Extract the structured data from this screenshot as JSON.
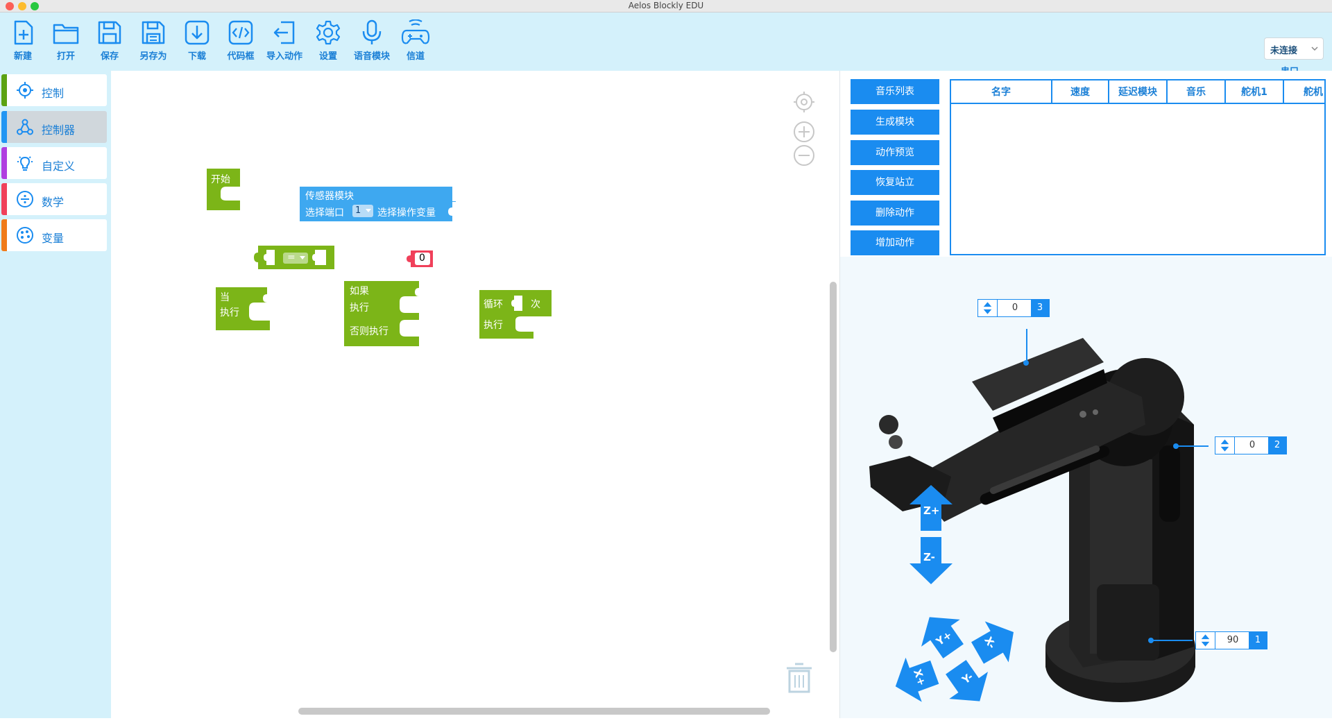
{
  "window": {
    "title": "Aelos Blockly EDU"
  },
  "toolbar": {
    "buttons": [
      {
        "label": "新建",
        "icon": "new-file-icon"
      },
      {
        "label": "打开",
        "icon": "folder-icon"
      },
      {
        "label": "保存",
        "icon": "save-icon"
      },
      {
        "label": "另存为",
        "icon": "save-as-icon"
      },
      {
        "label": "下载",
        "icon": "download-icon"
      },
      {
        "label": "代码框",
        "icon": "code-icon"
      },
      {
        "label": "导入动作",
        "icon": "import-icon"
      },
      {
        "label": "设置",
        "icon": "gear-icon"
      },
      {
        "label": "语音模块",
        "icon": "microphone-icon"
      },
      {
        "label": "信道",
        "icon": "gamepad-icon"
      }
    ],
    "connection": {
      "value": "未连接",
      "port_label": "串口"
    }
  },
  "sidebar": {
    "categories": [
      {
        "label": "控制",
        "color": "#5ba212"
      },
      {
        "label": "控制器",
        "color": "#2196f3"
      },
      {
        "label": "自定义",
        "color": "#b03ee0"
      },
      {
        "label": "数学",
        "color": "#f0405a"
      },
      {
        "label": "变量",
        "color": "#f07b1a"
      }
    ]
  },
  "workspace": {
    "blocks": {
      "start": "开始",
      "sensor_title": "传感器模块",
      "sensor_port_label": "选择端口",
      "sensor_port_value": "1",
      "sensor_var_label": "选择操作变量",
      "compare_op": "=",
      "number_value": "0",
      "while_label": "当",
      "while_do": "执行",
      "if_label": "如果",
      "if_do": "执行",
      "if_else": "否则执行",
      "loop_label": "循环",
      "loop_times": "次",
      "loop_do": "执行"
    },
    "colors": {
      "green": "#7cb518",
      "blue": "#3ea8f0",
      "red": "#f0405a"
    }
  },
  "actions": {
    "buttons": [
      "音乐列表",
      "生成模块",
      "动作预览",
      "恢复站立",
      "删除动作",
      "增加动作"
    ]
  },
  "table": {
    "columns": [
      "名字",
      "速度",
      "延迟模块",
      "音乐",
      "舵机1",
      "舵机"
    ]
  },
  "servos": [
    {
      "value": "0",
      "index": "3"
    },
    {
      "value": "0",
      "index": "2"
    },
    {
      "value": "90",
      "index": "1"
    }
  ],
  "axis_controls": [
    "Z+",
    "Z-",
    "Y+",
    "X-",
    "X+",
    "Y-"
  ],
  "accent": "#1a8cf0"
}
